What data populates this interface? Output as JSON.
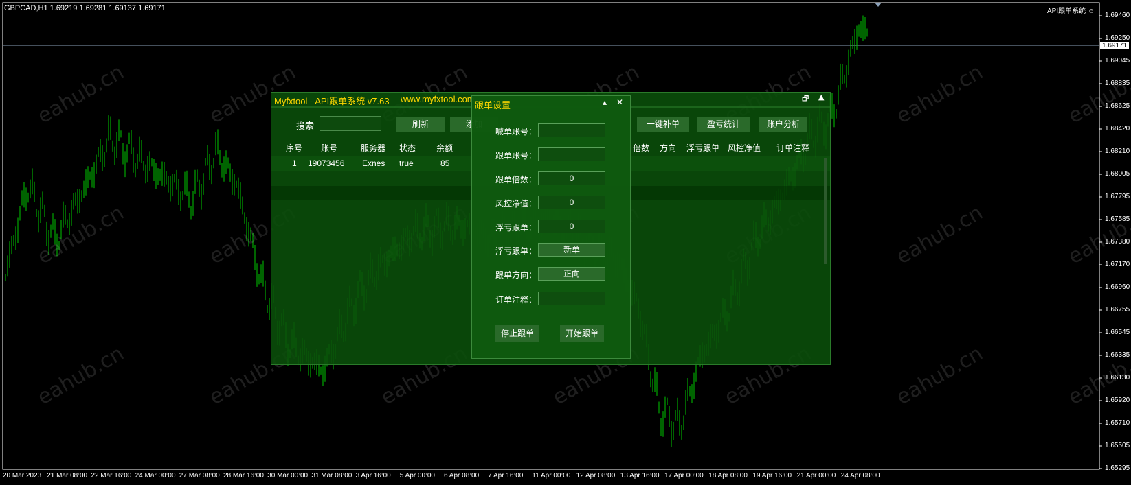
{
  "chart": {
    "symbol_info": "GBPCAD,H1  1.69219 1.69281 1.69137 1.69171",
    "ea_name": "API跟单系统",
    "current_price": "1.69171",
    "price_labels": [
      "1.69460",
      "1.69250",
      "1.69045",
      "1.68835",
      "1.68625",
      "1.68420",
      "1.68210",
      "1.68005",
      "1.67795",
      "1.67585",
      "1.67380",
      "1.67170",
      "1.66960",
      "1.66755",
      "1.66545",
      "1.66335",
      "1.66130",
      "1.65920",
      "1.65710",
      "1.65505",
      "1.65295"
    ],
    "time_labels": [
      "20 Mar 2023",
      "21 Mar 08:00",
      "22 Mar 16:00",
      "24 Mar 00:00",
      "27 Mar 08:00",
      "28 Mar 16:00",
      "30 Mar 00:00",
      "31 Mar 08:00",
      "3 Apr 16:00",
      "5 Apr 00:00",
      "6 Apr 08:00",
      "7 Apr 16:00",
      "11 Apr 00:00",
      "12 Apr 08:00",
      "13 Apr 16:00",
      "17 Apr 00:00",
      "18 Apr 08:00",
      "19 Apr 16:00",
      "21 Apr 00:00",
      "24 Apr 08:00"
    ],
    "watermark": "eahub.cn",
    "colors": {
      "candle": "#00c800",
      "background": "#000000"
    }
  },
  "panel": {
    "title": "Myfxtool - API跟单系统 v7.63",
    "url": "www.myfxtool.com",
    "search_label": "搜索",
    "search_value": "",
    "buttons": {
      "refresh": "刷新",
      "add": "添加",
      "fill": "一键补单",
      "pnl": "盈亏统计",
      "account": "账户分析"
    },
    "columns": [
      "序号",
      "账号",
      "服务器",
      "状态",
      "余额",
      "倍数",
      "方向",
      "浮亏跟单",
      "风控净值",
      "订单注释"
    ],
    "rows": [
      {
        "no": "1",
        "account": "19073456",
        "server": "Exnes",
        "status": "true",
        "balance": "85"
      }
    ]
  },
  "dialog": {
    "title": "跟单设置",
    "fields": {
      "shout_account": {
        "label": "喊单账号：",
        "value": ""
      },
      "follow_account": {
        "label": "跟单账号：",
        "value": ""
      },
      "multiplier": {
        "label": "跟单倍数：",
        "value": "0"
      },
      "risk_equity": {
        "label": "风控净值：",
        "value": "0"
      },
      "float_loss": {
        "label": "浮亏跟单：",
        "value": "0"
      },
      "float_loss_mode": {
        "label": "浮亏跟单：",
        "value": "新单"
      },
      "direction": {
        "label": "跟单方向：",
        "value": "正向"
      },
      "comment": {
        "label": "订单注释：",
        "value": ""
      }
    },
    "stop_label": "停止跟单",
    "start_label": "开始跟单"
  }
}
